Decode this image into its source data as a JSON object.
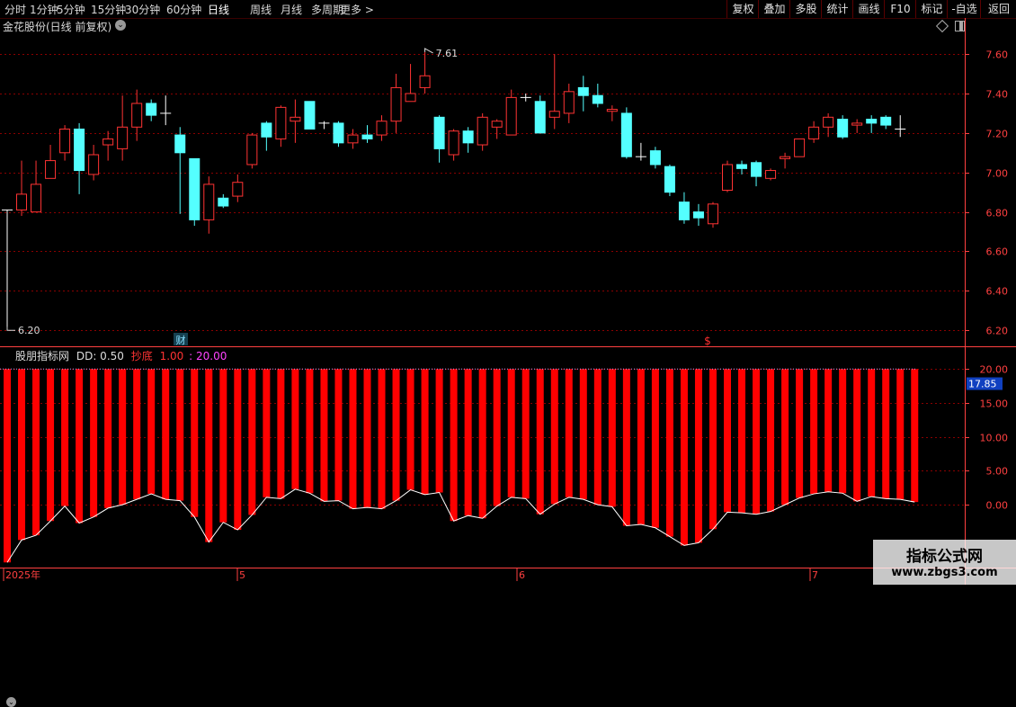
{
  "toolbar": {
    "periods": [
      "分时",
      "1分钟",
      "5分钟",
      "15分钟",
      "30分钟",
      "60分钟",
      "日线",
      "周线",
      "月线",
      "多周期",
      "更多 >"
    ],
    "active_period": "日线",
    "right_buttons": [
      "复权",
      "叠加",
      "多股",
      "统计",
      "画线",
      "F10",
      "标记",
      "-自选",
      "返回"
    ]
  },
  "chart": {
    "title": "金花股份(日线 前复权)",
    "high_label": "7.61",
    "low_label": "6.20",
    "markers": [
      "财",
      "$"
    ]
  },
  "indicator": {
    "name": "股朋指标网",
    "dd": "DD: 0.50",
    "signal_label": "抄底",
    "signal_value": "1.00",
    "level_value": ": 20.00",
    "current_value": "17.85"
  },
  "date_axis": [
    "2025年",
    "5",
    "6",
    "7"
  ],
  "watermark": {
    "title": "指标公式网",
    "url": "www.zbgs3.com"
  },
  "colors": {
    "up": "#ff3333",
    "down": "#54ffff",
    "grid": "#8a0000",
    "axis": "#ff4040",
    "bar": "#ff0000",
    "line": "#ffffff",
    "label_bg": "#1040c0"
  },
  "chart_data": [
    {
      "type": "candlestick",
      "title": "金花股份(日线 前复权)",
      "y_ticks": [
        7.6,
        7.4,
        7.2,
        7.0,
        6.8,
        6.6,
        6.4,
        6.2
      ],
      "ylim": [
        6.16,
        7.71
      ],
      "grid": true,
      "series": [
        {
          "o": 6.81,
          "h": 6.81,
          "l": 6.2,
          "c": 6.81,
          "t": "x"
        },
        {
          "o": 6.81,
          "h": 7.06,
          "l": 6.78,
          "c": 6.89,
          "t": "u"
        },
        {
          "o": 6.8,
          "h": 7.06,
          "l": 6.8,
          "c": 6.94,
          "t": "u"
        },
        {
          "o": 6.97,
          "h": 7.14,
          "l": 6.97,
          "c": 7.06,
          "t": "u"
        },
        {
          "o": 7.1,
          "h": 7.24,
          "l": 7.06,
          "c": 7.22,
          "t": "u"
        },
        {
          "o": 7.22,
          "h": 7.25,
          "l": 6.89,
          "c": 7.01,
          "t": "d"
        },
        {
          "o": 6.99,
          "h": 7.14,
          "l": 6.96,
          "c": 7.09,
          "t": "u"
        },
        {
          "o": 7.14,
          "h": 7.21,
          "l": 7.06,
          "c": 7.17,
          "t": "u"
        },
        {
          "o": 7.12,
          "h": 7.39,
          "l": 7.06,
          "c": 7.23,
          "t": "u"
        },
        {
          "o": 7.23,
          "h": 7.42,
          "l": 7.16,
          "c": 7.35,
          "t": "u"
        },
        {
          "o": 7.35,
          "h": 7.37,
          "l": 7.26,
          "c": 7.29,
          "t": "d"
        },
        {
          "o": 7.3,
          "h": 7.39,
          "l": 7.24,
          "c": 7.29,
          "t": "x"
        },
        {
          "o": 7.19,
          "h": 7.23,
          "l": 6.79,
          "c": 7.1,
          "t": "d"
        },
        {
          "o": 7.07,
          "h": 7.07,
          "l": 6.73,
          "c": 6.76,
          "t": "d"
        },
        {
          "o": 6.76,
          "h": 6.98,
          "l": 6.69,
          "c": 6.94,
          "t": "u"
        },
        {
          "o": 6.87,
          "h": 6.89,
          "l": 6.82,
          "c": 6.83,
          "t": "d"
        },
        {
          "o": 6.88,
          "h": 6.99,
          "l": 6.85,
          "c": 6.95,
          "t": "u"
        },
        {
          "o": 7.04,
          "h": 7.2,
          "l": 7.02,
          "c": 7.19,
          "t": "u"
        },
        {
          "o": 7.25,
          "h": 7.26,
          "l": 7.11,
          "c": 7.18,
          "t": "d"
        },
        {
          "o": 7.17,
          "h": 7.34,
          "l": 7.13,
          "c": 7.33,
          "t": "u"
        },
        {
          "o": 7.26,
          "h": 7.37,
          "l": 7.15,
          "c": 7.28,
          "t": "u"
        },
        {
          "o": 7.36,
          "h": 7.36,
          "l": 7.22,
          "c": 7.22,
          "t": "d"
        },
        {
          "o": 7.25,
          "h": 7.26,
          "l": 7.22,
          "c": 7.25,
          "t": "x"
        },
        {
          "o": 7.25,
          "h": 7.26,
          "l": 7.13,
          "c": 7.15,
          "t": "d"
        },
        {
          "o": 7.15,
          "h": 7.22,
          "l": 7.12,
          "c": 7.19,
          "t": "u"
        },
        {
          "o": 7.19,
          "h": 7.24,
          "l": 7.15,
          "c": 7.17,
          "t": "d"
        },
        {
          "o": 7.19,
          "h": 7.29,
          "l": 7.16,
          "c": 7.26,
          "t": "u"
        },
        {
          "o": 7.26,
          "h": 7.5,
          "l": 7.2,
          "c": 7.43,
          "t": "u"
        },
        {
          "o": 7.36,
          "h": 7.55,
          "l": 7.36,
          "c": 7.4,
          "t": "u"
        },
        {
          "o": 7.43,
          "h": 7.61,
          "l": 7.4,
          "c": 7.49,
          "t": "u"
        },
        {
          "o": 7.28,
          "h": 7.29,
          "l": 7.05,
          "c": 7.12,
          "t": "d"
        },
        {
          "o": 7.09,
          "h": 7.22,
          "l": 7.06,
          "c": 7.21,
          "t": "u"
        },
        {
          "o": 7.21,
          "h": 7.23,
          "l": 7.1,
          "c": 7.15,
          "t": "d"
        },
        {
          "o": 7.14,
          "h": 7.3,
          "l": 7.11,
          "c": 7.28,
          "t": "u"
        },
        {
          "o": 7.23,
          "h": 7.27,
          "l": 7.17,
          "c": 7.26,
          "t": "u"
        },
        {
          "o": 7.19,
          "h": 7.42,
          "l": 7.19,
          "c": 7.38,
          "t": "u"
        },
        {
          "o": 7.38,
          "h": 7.4,
          "l": 7.36,
          "c": 7.38,
          "t": "x"
        },
        {
          "o": 7.36,
          "h": 7.39,
          "l": 7.2,
          "c": 7.2,
          "t": "d"
        },
        {
          "o": 7.28,
          "h": 7.6,
          "l": 7.22,
          "c": 7.31,
          "t": "u"
        },
        {
          "o": 7.3,
          "h": 7.45,
          "l": 7.25,
          "c": 7.41,
          "t": "u"
        },
        {
          "o": 7.43,
          "h": 7.49,
          "l": 7.31,
          "c": 7.39,
          "t": "d"
        },
        {
          "o": 7.39,
          "h": 7.45,
          "l": 7.33,
          "c": 7.35,
          "t": "d"
        },
        {
          "o": 7.31,
          "h": 7.34,
          "l": 7.26,
          "c": 7.32,
          "t": "u"
        },
        {
          "o": 7.3,
          "h": 7.33,
          "l": 7.07,
          "c": 7.08,
          "t": "d"
        },
        {
          "o": 7.08,
          "h": 7.15,
          "l": 7.06,
          "c": 7.08,
          "t": "x"
        },
        {
          "o": 7.11,
          "h": 7.13,
          "l": 7.02,
          "c": 7.04,
          "t": "d"
        },
        {
          "o": 7.03,
          "h": 7.04,
          "l": 6.88,
          "c": 6.9,
          "t": "d"
        },
        {
          "o": 6.85,
          "h": 6.9,
          "l": 6.74,
          "c": 6.76,
          "t": "d"
        },
        {
          "o": 6.8,
          "h": 6.84,
          "l": 6.73,
          "c": 6.77,
          "t": "d"
        },
        {
          "o": 6.74,
          "h": 6.85,
          "l": 6.72,
          "c": 6.84,
          "t": "u"
        },
        {
          "o": 6.91,
          "h": 7.06,
          "l": 6.9,
          "c": 7.04,
          "t": "u"
        },
        {
          "o": 7.04,
          "h": 7.06,
          "l": 6.99,
          "c": 7.02,
          "t": "d"
        },
        {
          "o": 7.05,
          "h": 7.06,
          "l": 6.93,
          "c": 6.98,
          "t": "d"
        },
        {
          "o": 6.97,
          "h": 7.02,
          "l": 6.96,
          "c": 7.01,
          "t": "u"
        },
        {
          "o": 7.07,
          "h": 7.1,
          "l": 7.02,
          "c": 7.08,
          "t": "u"
        },
        {
          "o": 7.08,
          "h": 7.17,
          "l": 7.08,
          "c": 7.17,
          "t": "u"
        },
        {
          "o": 7.17,
          "h": 7.26,
          "l": 7.15,
          "c": 7.23,
          "t": "u"
        },
        {
          "o": 7.23,
          "h": 7.3,
          "l": 7.18,
          "c": 7.28,
          "t": "u"
        },
        {
          "o": 7.27,
          "h": 7.29,
          "l": 7.17,
          "c": 7.18,
          "t": "d"
        },
        {
          "o": 7.24,
          "h": 7.27,
          "l": 7.2,
          "c": 7.25,
          "t": "u"
        },
        {
          "o": 7.27,
          "h": 7.29,
          "l": 7.2,
          "c": 7.25,
          "t": "d"
        },
        {
          "o": 7.28,
          "h": 7.29,
          "l": 7.22,
          "c": 7.24,
          "t": "d"
        },
        {
          "o": 7.22,
          "h": 7.29,
          "l": 7.18,
          "c": 7.22,
          "t": "x"
        }
      ]
    },
    {
      "type": "bar",
      "title": "股朋指标网",
      "y_ticks": [
        20.0,
        15.0,
        10.0,
        5.0,
        0.0
      ],
      "ylim": [
        -9.0,
        21.5
      ],
      "grid": true,
      "bar_value": 20.0,
      "line": [
        -8.5,
        -5.2,
        -4.5,
        -2.4,
        -0.2,
        -2.7,
        -1.8,
        -0.5,
        0.0,
        0.8,
        1.6,
        0.8,
        0.6,
        -1.8,
        -5.5,
        -2.6,
        -3.7,
        -1.5,
        1.1,
        0.9,
        2.3,
        1.7,
        0.5,
        0.6,
        -0.6,
        -0.4,
        -0.6,
        0.6,
        2.2,
        1.5,
        1.8,
        -2.4,
        -1.6,
        -2.0,
        -0.2,
        1.1,
        0.9,
        -1.4,
        0.1,
        1.1,
        0.8,
        0.0,
        -0.3,
        -3.1,
        -2.9,
        -3.4,
        -4.7,
        -6.0,
        -5.6,
        -3.6,
        -1.1,
        -1.2,
        -1.4,
        -1.0,
        0.0,
        1.0,
        1.6,
        1.9,
        1.7,
        0.5,
        1.2,
        0.9,
        0.8,
        0.4
      ]
    }
  ]
}
